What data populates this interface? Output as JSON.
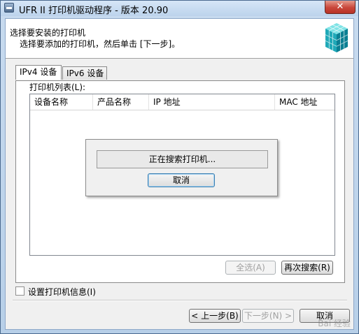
{
  "window": {
    "title": "UFR II 打印机驱动程序 - 版本 20.90",
    "close_label": "✕"
  },
  "header": {
    "title": "选择要安装的打印机",
    "subtitle": "选择要添加的打印机，然后单击 [下一步]。"
  },
  "tabs": [
    {
      "label": "IPv4 设备",
      "active": true
    },
    {
      "label": "IPv6 设备",
      "active": false
    }
  ],
  "printer_list": {
    "label": "打印机列表(L):",
    "columns": [
      "设备名称",
      "产品名称",
      "IP 地址",
      "MAC 地址"
    ]
  },
  "search_dialog": {
    "status": "正在搜索打印机...",
    "cancel_label": "取消"
  },
  "list_buttons": {
    "select_all_label": "全选(A)",
    "search_again_label": "再次搜索(R)"
  },
  "options": {
    "set_printer_info_label": "设置打印机信息(I)",
    "set_printer_info_checked": false
  },
  "footer": {
    "back_label": "< 上一步(B)",
    "next_label": "下一步(N) >",
    "cancel_label": "取消"
  },
  "watermark": "Bai 经验"
}
